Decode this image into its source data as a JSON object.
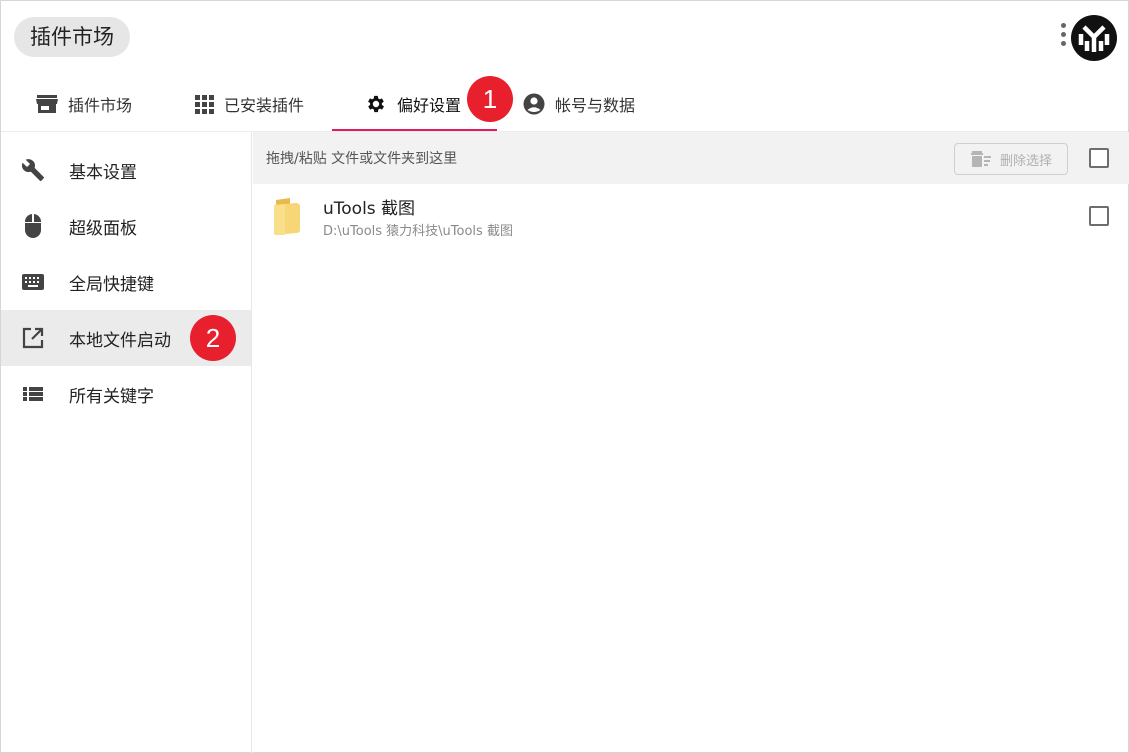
{
  "header": {
    "search_label": "插件市场"
  },
  "tabs": [
    {
      "label": "插件市场",
      "icon": "store-icon"
    },
    {
      "label": "已安装插件",
      "icon": "apps-grid-icon"
    },
    {
      "label": "偏好设置",
      "icon": "gear-icon",
      "active": true
    },
    {
      "label": "帐号与数据",
      "icon": "account-circle-icon"
    }
  ],
  "annotations": {
    "badge_1": "1",
    "badge_2": "2"
  },
  "sidebar": {
    "items": [
      {
        "label": "基本设置",
        "icon": "wrench-icon"
      },
      {
        "label": "超级面板",
        "icon": "mouse-icon"
      },
      {
        "label": "全局快捷键",
        "icon": "keyboard-icon"
      },
      {
        "label": "本地文件启动",
        "icon": "open-in-new-icon",
        "active": true
      },
      {
        "label": "所有关键字",
        "icon": "list-icon"
      }
    ]
  },
  "main": {
    "drop_hint": "拖拽/粘贴 文件或文件夹到这里",
    "delete_label": "删除选择",
    "files": [
      {
        "name": "uTools 截图",
        "path": "D:\\uTools 猿力科技\\uTools 截图",
        "icon": "folder-icon"
      }
    ]
  },
  "colors": {
    "accent": "#e5195e",
    "badge": "#e8202e",
    "folder": "#f6d676"
  }
}
